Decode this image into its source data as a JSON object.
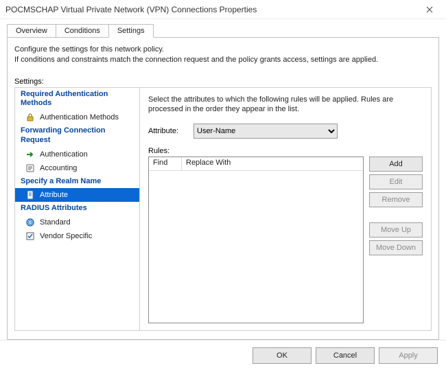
{
  "window": {
    "title": "POCMSCHAP Virtual Private Network (VPN) Connections Properties"
  },
  "tabs": [
    {
      "label": "Overview",
      "selected": false
    },
    {
      "label": "Conditions",
      "selected": false
    },
    {
      "label": "Settings",
      "selected": true
    }
  ],
  "intro_line1": "Configure the settings for this network policy.",
  "intro_line2": "If conditions and constraints match the connection request and the policy grants access, settings are applied.",
  "settings_label": "Settings:",
  "nav": {
    "sections": [
      {
        "title": "Required Authentication Methods",
        "items": [
          {
            "label": "Authentication Methods",
            "icon": "lock",
            "selected": false
          }
        ]
      },
      {
        "title": "Forwarding Connection Request",
        "items": [
          {
            "label": "Authentication",
            "icon": "arrow-right",
            "selected": false
          },
          {
            "label": "Accounting",
            "icon": "book",
            "selected": false
          }
        ]
      },
      {
        "title": "Specify a Realm Name",
        "items": [
          {
            "label": "Attribute",
            "icon": "doc",
            "selected": true
          }
        ]
      },
      {
        "title": "RADIUS Attributes",
        "items": [
          {
            "label": "Standard",
            "icon": "globe",
            "selected": false
          },
          {
            "label": "Vendor Specific",
            "icon": "checkbox",
            "selected": false
          }
        ]
      }
    ]
  },
  "content": {
    "description": "Select the attributes to which the following rules will be applied. Rules are processed in the order they appear in the list.",
    "attribute_label": "Attribute:",
    "attribute_selected": "User-Name",
    "rules_label": "Rules:",
    "columns": {
      "find": "Find",
      "replace_with": "Replace With"
    },
    "rows": [],
    "buttons": {
      "add": "Add",
      "edit": "Edit",
      "remove": "Remove",
      "move_up": "Move Up",
      "move_down": "Move Down"
    }
  },
  "footer": {
    "ok": "OK",
    "cancel": "Cancel",
    "apply": "Apply"
  }
}
